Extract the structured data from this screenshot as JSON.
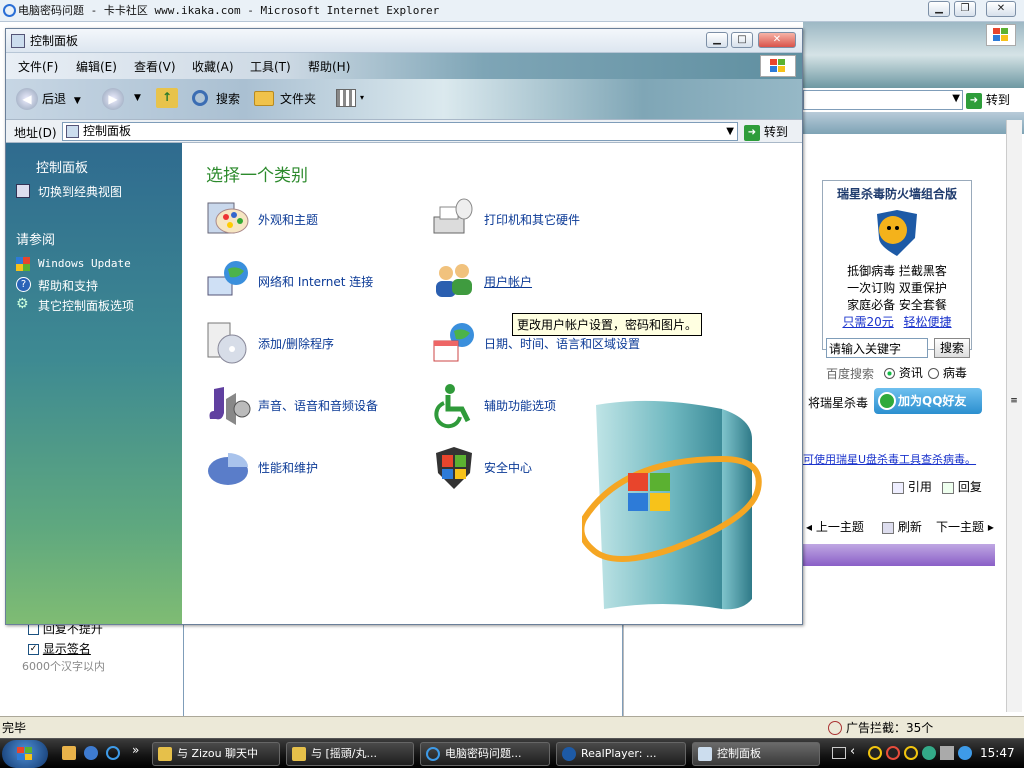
{
  "bg_window": {
    "title": "电脑密码问题 - 卡卡社区 www.ikaka.com - Microsoft Internet Explorer",
    "go_label": "转到",
    "status": "完毕",
    "ad_block": "广告拦截：35个"
  },
  "ad_panel": {
    "title": "瑞星杀毒防火墙组合版",
    "lines": [
      "抵御病毒  拦截黑客",
      "一次订购  双重保护",
      "家庭必备  安全套餐"
    ],
    "price": "只需20元",
    "easy": "轻松便捷",
    "search_placeholder": "请输入关键字",
    "search_button": "搜索",
    "baidu": "百度搜索",
    "radio_news": "资讯",
    "radio_virus": "病毒",
    "rising_label": "将瑞星杀毒",
    "qq_button": "加为QQ好友",
    "ulink": "可使用瑞星U盘杀毒工具查杀病毒。",
    "quote": "引用",
    "reply": "回复",
    "prev": "上一主题",
    "refresh": "刷新",
    "next": "下一主题"
  },
  "form_bottom": {
    "no_top": "回复不提升",
    "show_sig": "显示签名",
    "limit": "6000个汉字以内"
  },
  "cp": {
    "title": "控制面板",
    "menu": [
      "文件(F)",
      "编辑(E)",
      "查看(V)",
      "收藏(A)",
      "工具(T)",
      "帮助(H)"
    ],
    "toolbar": {
      "back": "后退",
      "search": "搜索",
      "folders": "文件夹"
    },
    "address_label": "地址(D)",
    "address_value": "控制面板",
    "go_label": "转到",
    "sidebar": {
      "panel_title": "控制面板",
      "switch_view": "切换到经典视图",
      "see_also": "请参阅",
      "items": [
        "Windows Update",
        "帮助和支持",
        "其它控制面板选项"
      ]
    },
    "heading": "选择一个类别",
    "categories": [
      "外观和主题",
      "打印机和其它硬件",
      "网络和 Internet 连接",
      "用户帐户",
      "添加/删除程序",
      "日期、时间、语言和区域设置",
      "声音、语音和音频设备",
      "辅助功能选项",
      "性能和维护",
      "安全中心"
    ],
    "tooltip": "更改用户帐户设置，密码和图片。"
  },
  "taskbar": {
    "tasks": [
      "与 Zizou 聊天中",
      "与 [摇頭/丸...",
      "电脑密码问题...",
      "RealPlayer: ...",
      "控制面板"
    ],
    "clock": "15:47"
  }
}
